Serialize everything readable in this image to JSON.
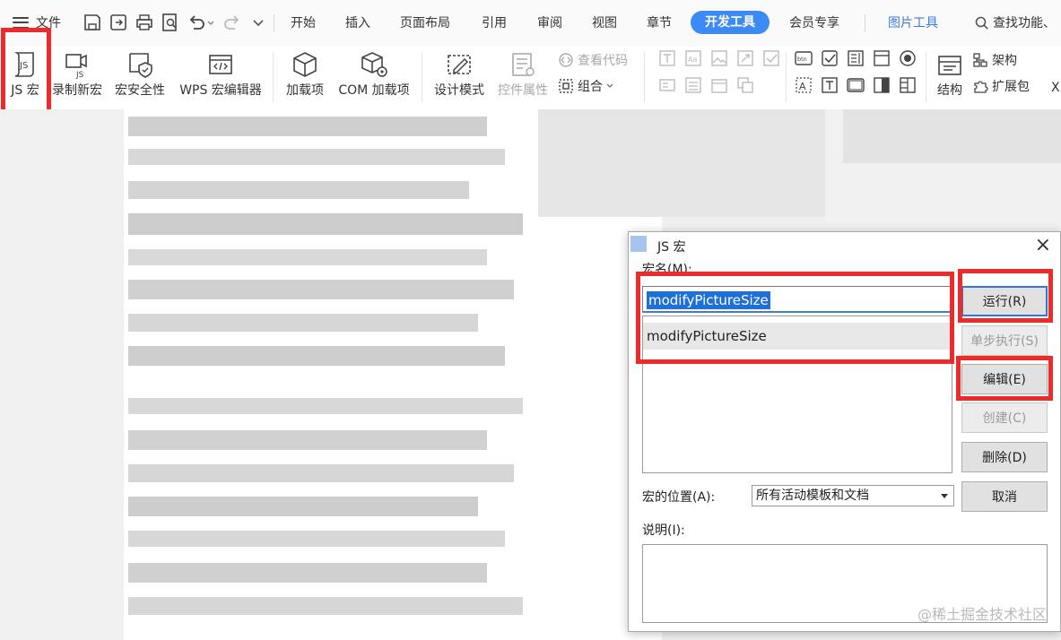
{
  "menubar": {
    "file_label": "文件",
    "tabs": [
      "开始",
      "插入",
      "页面布局",
      "引用",
      "审阅",
      "视图",
      "章节",
      "开发工具",
      "会员专享",
      "图片工具"
    ],
    "search_label": "查找功能、"
  },
  "ribbon": {
    "js_macro": "JS 宏",
    "record_macro": "录制新宏",
    "macro_security": "宏安全性",
    "wps_macro_editor": "WPS 宏编辑器",
    "addins": "加载项",
    "com_addins": "COM 加载项",
    "design_mode": "设计模式",
    "control_props": "控件属性",
    "view_code": "查看代码",
    "group": "组合",
    "structure": "结构",
    "architecture": "架构",
    "extension_pack": "扩展包",
    "more_label": "X"
  },
  "dialog": {
    "title": "JS 宏",
    "macro_name_label": "宏名(M):",
    "macro_name_value": "modifyPictureSize",
    "macro_list": [
      "modifyPictureSize"
    ],
    "location_label": "宏的位置(A):",
    "location_value": "所有活动模板和文档",
    "description_label": "说明(I):",
    "buttons": {
      "run": "运行(R)",
      "step": "单步执行(S)",
      "edit": "编辑(E)",
      "create": "创建(C)",
      "delete": "删除(D)",
      "cancel": "取消"
    }
  },
  "watermark": "@稀土掘金技术社区",
  "colors": {
    "accent": "#3b8af5",
    "highlight_box": "#ee2a2a",
    "selection": "#1e6fd9"
  }
}
